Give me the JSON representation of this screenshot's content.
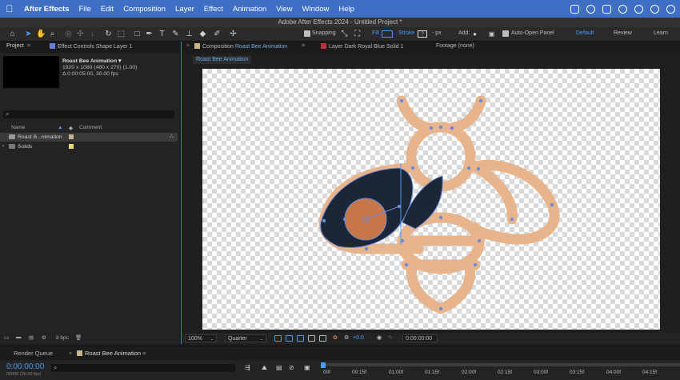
{
  "menubar": {
    "apple": "",
    "items": [
      "After Effects",
      "File",
      "Edit",
      "Composition",
      "Layer",
      "Effect",
      "Animation",
      "View",
      "Window",
      "Help"
    ]
  },
  "window": {
    "title": "Adobe After Effects 2024 - Untitled Project *"
  },
  "toolbar": {
    "snapping_label": "Snapping",
    "fill_label": "Fill",
    "stroke_label": "Stroke",
    "stroke_value": "?",
    "stroke_unit": "- px",
    "add_label": "Add:",
    "auto_open_label": "Auto-Open Panel",
    "workspaces": [
      "Default",
      "Review",
      "Learn"
    ]
  },
  "project": {
    "tab_label": "Project",
    "effect_controls_label": "Effect Controls Shape Layer 1",
    "comp_name": "Roast Bee Animation ▾",
    "comp_size": "1920 x 1080  (480 x 270) (1.00)",
    "comp_duration": "Δ 0:00:05:00, 30.00 fps",
    "search_icon": "⌕",
    "col_name": "Name",
    "col_comment": "Comment",
    "items": [
      {
        "name": "Roast B...nimation",
        "selected": true,
        "color": "#c9b48a"
      },
      {
        "name": "Solids",
        "selected": false,
        "color": "#e8e06a"
      }
    ],
    "bpc": "8 bpc"
  },
  "composition": {
    "tab_prefix": "Composition",
    "tab_name": "Roast Bee Animation",
    "layer_tab": "Layer Dark Royal Blue Solid 1",
    "footage_tab": "Footage (none)",
    "subtab": "Roast Bee Animation",
    "zoom": "100%",
    "resolution": "Quarter",
    "exposure": "+0.0",
    "timecode": "0:00:00:00"
  },
  "timeline": {
    "render_queue": "Render Queue",
    "comp_tab": "Roast Bee Animation",
    "timecode": "0:00:00:00",
    "fps": "00000 (30.00 fps)",
    "ruler": [
      "00f",
      "00:15f",
      "01:00f",
      "01:15f",
      "02:00f",
      "02:15f",
      "03:00f",
      "03:15f",
      "04:00f",
      "04:15f"
    ]
  },
  "colors": {
    "accent": "#4a9cf0",
    "bee_outline": "#e8b48c",
    "wing_fill": "#1b2636",
    "body_circle": "#c8774a",
    "project_label": "#c9b48a",
    "solids_label": "#e8e06a",
    "layer_tab_chip": "#c0303a"
  }
}
